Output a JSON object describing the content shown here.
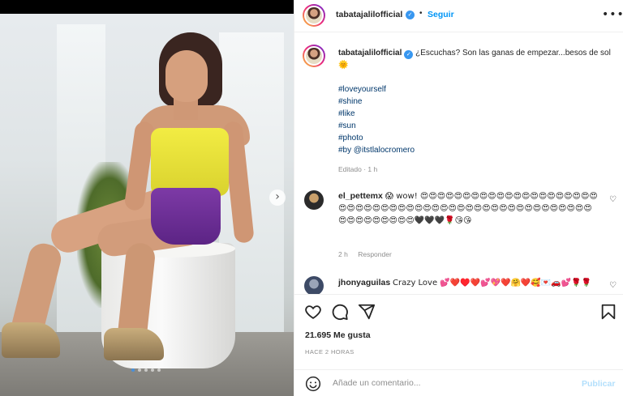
{
  "post": {
    "username": "tabatajalilofficial",
    "follow_label": "Seguir",
    "separator": "•",
    "more_icon": "more-options-icon",
    "caption": {
      "text": "¿Escuchas? Son las ganas de empezar...besos de sol 🌞",
      "hashtags": [
        "#loveyourself",
        "#shine",
        "#like",
        "#sun",
        "#photo",
        "#by @itstlalocromero"
      ],
      "edited": "Editado · 1 h"
    },
    "comments": [
      {
        "username": "el_pettemx",
        "text": "😱 wow! 😍😍😍😍😍😍😍😍😍😍😍😍😍😍😍😍😍😍😍😍😍😍😍😍😍😍😍😍😍😍😍😍😍😍😍😍😍😍😍😍😍😍😍😍😍😍😍😍😍😍😍😍😍😍😍😍😍😍😍😍🖤🖤🖤🌹😘😘",
        "time": "2 h",
        "reply_label": "Responder"
      },
      {
        "username": "jhonyaguilas",
        "text": "Crazy Love 💕❤️♥️❤️💕💖❤️🤗❤️🥰💌🚗💕🌹🌹"
      }
    ],
    "likes": "21.695 Me gusta",
    "posted_ago": "HACE 2 HORAS",
    "comment_placeholder": "Añade un comentario...",
    "publish_label": "Publicar"
  },
  "carousel": {
    "next_icon": "chevron-right-icon",
    "slides": 5,
    "current": 1
  },
  "colors": {
    "link": "#00376b",
    "accent": "#0095f6",
    "verified": "#3897f0",
    "muted": "#8e8e8e"
  }
}
